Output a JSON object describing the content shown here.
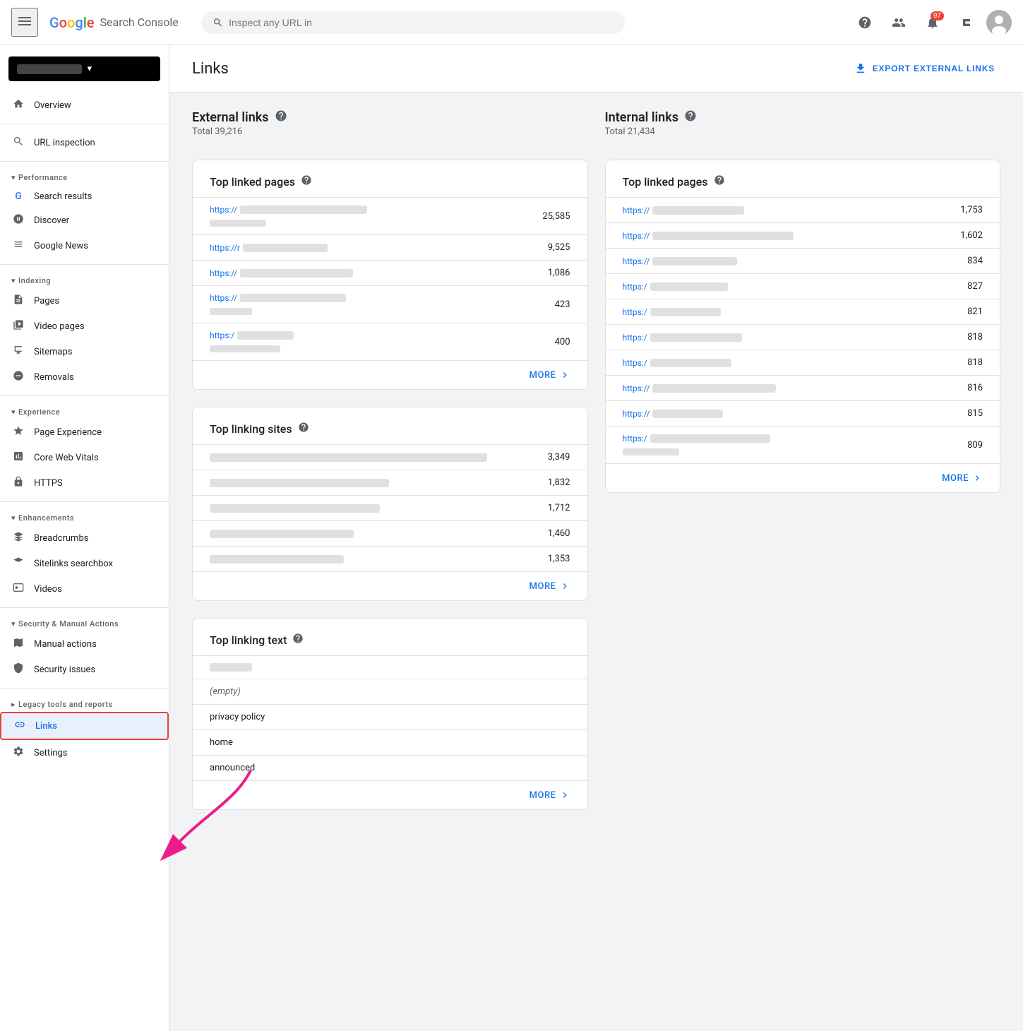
{
  "topNav": {
    "menuLabel": "☰",
    "logoGoogle": "Google",
    "logoSC": "Search Console",
    "searchPlaceholder": "Inspect any URL in",
    "helpIcon": "?",
    "accountIcon": "👤",
    "notificationCount": "97",
    "appsIcon": "⊞"
  },
  "sidebar": {
    "propertyName": "",
    "sections": [
      {
        "id": "root",
        "label": "",
        "items": [
          {
            "id": "overview",
            "label": "Overview",
            "icon": "🏠"
          }
        ]
      },
      {
        "id": "root2",
        "label": "",
        "items": [
          {
            "id": "url-inspection",
            "label": "URL inspection",
            "icon": "🔍"
          }
        ]
      },
      {
        "id": "performance",
        "label": "Performance",
        "items": [
          {
            "id": "search-results",
            "label": "Search results",
            "icon": "G"
          },
          {
            "id": "discover",
            "label": "Discover",
            "icon": "✳"
          },
          {
            "id": "google-news",
            "label": "Google News",
            "icon": "🗞"
          }
        ]
      },
      {
        "id": "indexing",
        "label": "Indexing",
        "items": [
          {
            "id": "pages",
            "label": "Pages",
            "icon": "📄"
          },
          {
            "id": "video-pages",
            "label": "Video pages",
            "icon": "📋"
          },
          {
            "id": "sitemaps",
            "label": "Sitemaps",
            "icon": "🗺"
          },
          {
            "id": "removals",
            "label": "Removals",
            "icon": "🚫"
          }
        ]
      },
      {
        "id": "experience",
        "label": "Experience",
        "items": [
          {
            "id": "page-experience",
            "label": "Page Experience",
            "icon": "✦"
          },
          {
            "id": "core-web-vitals",
            "label": "Core Web Vitals",
            "icon": "📊"
          },
          {
            "id": "https",
            "label": "HTTPS",
            "icon": "🔒"
          }
        ]
      },
      {
        "id": "enhancements",
        "label": "Enhancements",
        "items": [
          {
            "id": "breadcrumbs",
            "label": "Breadcrumbs",
            "icon": "⬡"
          },
          {
            "id": "sitelinks-searchbox",
            "label": "Sitelinks searchbox",
            "icon": "⬡"
          },
          {
            "id": "videos",
            "label": "Videos",
            "icon": "⬡"
          }
        ]
      },
      {
        "id": "security",
        "label": "Security & Manual Actions",
        "items": [
          {
            "id": "manual-actions",
            "label": "Manual actions",
            "icon": "⚐"
          },
          {
            "id": "security-issues",
            "label": "Security issues",
            "icon": "🛡"
          }
        ]
      },
      {
        "id": "legacy",
        "label": "Legacy tools and reports",
        "items": [
          {
            "id": "links",
            "label": "Links",
            "icon": "⬡",
            "active": true
          },
          {
            "id": "settings",
            "label": "Settings",
            "icon": "⚙"
          }
        ]
      }
    ]
  },
  "page": {
    "title": "Links",
    "exportBtn": "EXPORT EXTERNAL LINKS"
  },
  "externalLinks": {
    "title": "External links",
    "total": "Total 39,216",
    "topLinkedPages": {
      "cardTitle": "Top linked pages",
      "rows": [
        {
          "url": "https://",
          "urlExtra": "blurred1",
          "count": "25,585",
          "hasSubBar": true
        },
        {
          "url": "https://r",
          "urlExtra": "blurred2",
          "count": "9,525",
          "hasSubBar": false
        },
        {
          "url": "https://",
          "urlExtra": "blurred3",
          "count": "1,086",
          "hasSubBar": false
        },
        {
          "url": "https://",
          "urlExtra": "blurred4",
          "count": "423",
          "hasSubBar": true
        },
        {
          "url": "https://",
          "urlExtra": "blurred5",
          "count": "400",
          "hasSubBar": true
        }
      ],
      "moreBtn": "MORE"
    },
    "topLinkingSites": {
      "cardTitle": "Top linking sites",
      "rows": [
        {
          "barWidth": "85%",
          "count": "3,349"
        },
        {
          "barWidth": "55%",
          "count": "1,832"
        },
        {
          "barWidth": "52%",
          "count": "1,712"
        },
        {
          "barWidth": "44%",
          "count": "1,460"
        },
        {
          "barWidth": "41%",
          "count": "1,353"
        }
      ],
      "moreBtn": "MORE"
    },
    "topLinkingText": {
      "cardTitle": "Top linking text",
      "rows": [
        {
          "type": "bar",
          "barWidth": "60px"
        },
        {
          "type": "text",
          "text": "(empty)",
          "italic": true
        },
        {
          "type": "text",
          "text": "privacy policy"
        },
        {
          "type": "text",
          "text": "home"
        },
        {
          "type": "text",
          "text": "announced"
        }
      ],
      "moreBtn": "MORE"
    }
  },
  "internalLinks": {
    "title": "Internal links",
    "total": "Total 21,434",
    "topLinkedPages": {
      "cardTitle": "Top linked pages",
      "rows": [
        {
          "url": "https://",
          "urlBlur": "blur1",
          "count": "1,753"
        },
        {
          "url": "https://",
          "urlBlur": "blur2",
          "count": "1,602",
          "hasSubBar": true
        },
        {
          "url": "https://",
          "urlBlur": "blur3",
          "count": "834"
        },
        {
          "url": "https://",
          "urlBlur": "blur4",
          "count": "827"
        },
        {
          "url": "https://",
          "urlBlur": "blur5",
          "count": "821"
        },
        {
          "url": "https://",
          "urlBlur": "blur6",
          "count": "818"
        },
        {
          "url": "https://",
          "urlBlur": "blur7",
          "count": "818"
        },
        {
          "url": "https://",
          "urlBlur": "blur8",
          "count": "816"
        },
        {
          "url": "https://",
          "urlBlur": "blur9",
          "count": "815"
        },
        {
          "url": "https://",
          "urlBlur": "blur10",
          "count": "809",
          "hasSubBar": true
        }
      ],
      "moreBtn": "MORE"
    }
  },
  "icons": {
    "chevronDown": "▾",
    "chevronRight": "›",
    "download": "⬇",
    "help": "?",
    "more": "›",
    "search": "🔍"
  },
  "colors": {
    "blue": "#1a73e8",
    "red": "#ea4335",
    "lightBlue": "#e8f0fe",
    "blurGray": "#e0e0e0",
    "black": "#000"
  }
}
